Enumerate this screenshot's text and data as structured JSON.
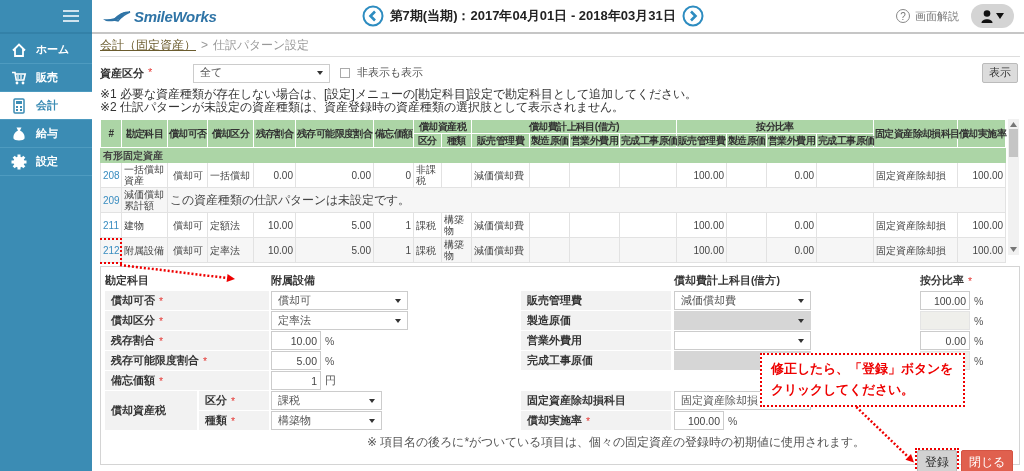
{
  "sidebar": {
    "items": [
      {
        "label": "ホーム",
        "selected": false
      },
      {
        "label": "販売",
        "selected": false
      },
      {
        "label": "会計",
        "selected": true
      },
      {
        "label": "給与",
        "selected": false
      },
      {
        "label": "設定",
        "selected": false
      }
    ]
  },
  "header": {
    "logo": "SmileWorks",
    "period": "第7期(当期)：2017年04月01日 - 2018年03月31日",
    "help": {
      "icon": "?",
      "label": "画面解説"
    }
  },
  "breadcrumb": {
    "separator": ">",
    "items": [
      {
        "label": "会計（固定資産）",
        "kind": "link"
      },
      {
        "label": "仕訳パターン設定",
        "kind": "current"
      }
    ]
  },
  "required_mark": "*",
  "filter": {
    "label": "資産区分",
    "required": true,
    "value": "全て",
    "checkbox": {
      "label": "非表示も表示",
      "checked": false
    },
    "button": "表示"
  },
  "notes": [
    "※1 必要な資産種類が存在しない場合は、[設定]メニューの[勘定科目]設定で勘定科目として追加してください。",
    "※2 仕訳パターンが未設定の資産種類は、資産登録時の資産種類の選択肢として表示されません。"
  ],
  "table": {
    "columns": [
      {
        "label": "#"
      },
      {
        "label": "勘定科目"
      },
      {
        "label": "償却可否"
      },
      {
        "label": "償却区分"
      },
      {
        "label": "残存割合"
      },
      {
        "label": "残存可能限度割合"
      },
      {
        "label": "備忘価額"
      },
      {
        "label": "償却資産税",
        "children": [
          {
            "label": "区分"
          },
          {
            "label": "種類"
          }
        ]
      },
      {
        "label": "償却費計上科目(借方)",
        "children": [
          {
            "label": "販売管理費"
          },
          {
            "label": "製造原価"
          },
          {
            "label": "営業外費用"
          },
          {
            "label": "完成工事原価"
          }
        ]
      },
      {
        "label": "按分比率",
        "children": [
          {
            "label": "販売管理費"
          },
          {
            "label": "製造原価"
          },
          {
            "label": "営業外費用"
          },
          {
            "label": "完成工事原価"
          }
        ]
      },
      {
        "label": "固定資産除却損科目"
      },
      {
        "label": "償却実施率"
      }
    ],
    "group": "有形固定資産",
    "rows": [
      {
        "kind": "pattern",
        "id": "208",
        "highlighted": false,
        "cells": [
          "一括償却資産",
          "償却可",
          "一括償却",
          "0.00",
          "0.00",
          "0",
          "非課税",
          null,
          "減価償却費",
          null,
          null,
          null,
          "100.00",
          null,
          "0.00",
          null,
          "固定資産除却損",
          "100.00"
        ]
      },
      {
        "kind": "unset",
        "id": "209",
        "highlighted": false,
        "account": "減価償却累計額",
        "message": "この資産種類の仕訳パターンは未設定です。"
      },
      {
        "kind": "pattern",
        "id": "211",
        "highlighted": false,
        "cells": [
          "建物",
          "償却可",
          "定額法",
          "10.00",
          "5.00",
          "1",
          "課税",
          "構築物",
          "減価償却費",
          null,
          null,
          null,
          "100.00",
          null,
          "0.00",
          null,
          "固定資産除却損",
          "100.00"
        ]
      },
      {
        "kind": "pattern",
        "id": "212",
        "highlighted": true,
        "cells": [
          "附属設備",
          "償却可",
          "定率法",
          "10.00",
          "5.00",
          "1",
          "課税",
          "構築物",
          "減価償却費",
          null,
          null,
          null,
          "100.00",
          null,
          "0.00",
          null,
          "固定資産除却損",
          "100.00"
        ]
      }
    ]
  },
  "form": {
    "account_label": "勘定科目",
    "account_value": "附属設備",
    "fields": [
      {
        "kind": "select",
        "label": "償却可否",
        "required": true,
        "value": "償却可"
      },
      {
        "kind": "select",
        "label": "償却区分",
        "required": true,
        "value": "定率法"
      },
      {
        "kind": "number",
        "label": "残存割合",
        "required": true,
        "value": "10.00",
        "unit": "%"
      },
      {
        "kind": "number",
        "label": "残存可能限度割合",
        "required": true,
        "value": "5.00",
        "unit": "%"
      },
      {
        "kind": "number",
        "label": "備忘価額",
        "required": true,
        "value": "1",
        "unit": "円"
      }
    ],
    "tax": {
      "label": "償却資産税",
      "fields": [
        {
          "kind": "select",
          "label": "区分",
          "required": true,
          "value": "課税"
        },
        {
          "kind": "select",
          "label": "種類",
          "required": true,
          "value": "構築物"
        }
      ]
    },
    "expense_heading": "償却費計上科目(借方)",
    "ratio_heading": "按分比率",
    "ratio_required": true,
    "expenses": [
      {
        "label": "販売管理費",
        "account": "減価償却費",
        "disabled": false,
        "ratio": "100.00",
        "unit": "%"
      },
      {
        "label": "製造原価",
        "disabled": true,
        "unit": "%"
      },
      {
        "label": "営業外費用",
        "disabled": false,
        "ratio": "0.00",
        "unit": "%"
      },
      {
        "label": "完成工事原価",
        "disabled": true,
        "unit": "%"
      }
    ],
    "retirement": {
      "label": "固定資産除却損科目",
      "value": "固定資産除却損"
    },
    "rate": {
      "label": "償却実施率",
      "required": true,
      "value": "100.00",
      "unit": "%"
    },
    "footnote": "※ 項目名の後ろに*がついている項目は、個々の固定資産の登録時の初期値に使用されます。"
  },
  "buttons": [
    {
      "label": "登録",
      "kind": "register",
      "highlighted": true
    },
    {
      "label": "閉じる",
      "kind": "close",
      "highlighted": false
    }
  ],
  "callout": {
    "lines": [
      "修正したら、「登録」ボタンを",
      "クリックしてください。"
    ]
  }
}
